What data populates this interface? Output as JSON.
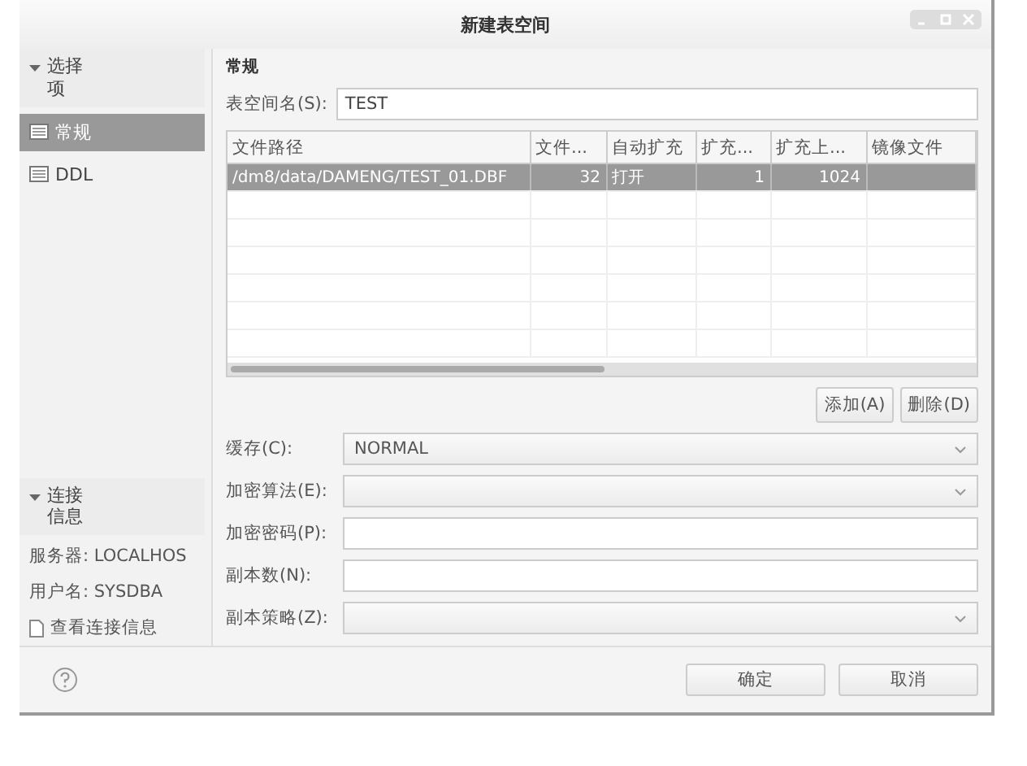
{
  "window": {
    "title": "新建表空间"
  },
  "sidebar": {
    "sections": [
      {
        "title": "选择项",
        "expanded": true,
        "items": [
          {
            "label": "常规",
            "selected": true
          },
          {
            "label": "DDL",
            "selected": false
          }
        ]
      },
      {
        "title": "连接信息",
        "expanded": true,
        "info": [
          "服务器: LOCALHOS",
          "用户名: SYSDBA"
        ],
        "link": "查看连接信息"
      }
    ]
  },
  "section_title": "常规",
  "name_field": {
    "label": "表空间名(S):",
    "value": "TEST"
  },
  "table": {
    "columns": [
      "文件路径",
      "文件...",
      "自动扩充",
      "扩充...",
      "扩充上...",
      "镜像文件"
    ],
    "rows": [
      {
        "cells": [
          "/dm8/data/DAMENG/TEST_01.DBF",
          "32",
          "打开",
          "1",
          "1024",
          ""
        ],
        "selected": true
      }
    ]
  },
  "table_buttons": [
    "添加(A)",
    "删除(D)"
  ],
  "fields": [
    {
      "kind": "select",
      "label": "缓存(C):",
      "value": "NORMAL"
    },
    {
      "kind": "select",
      "label": "加密算法(E):"
    },
    {
      "kind": "input",
      "label": "加密密码(P):"
    },
    {
      "kind": "input",
      "label": "副本数(N):"
    },
    {
      "kind": "select",
      "label": "副本策略(Z):"
    }
  ],
  "footer_buttons": [
    "确定",
    "取消"
  ]
}
